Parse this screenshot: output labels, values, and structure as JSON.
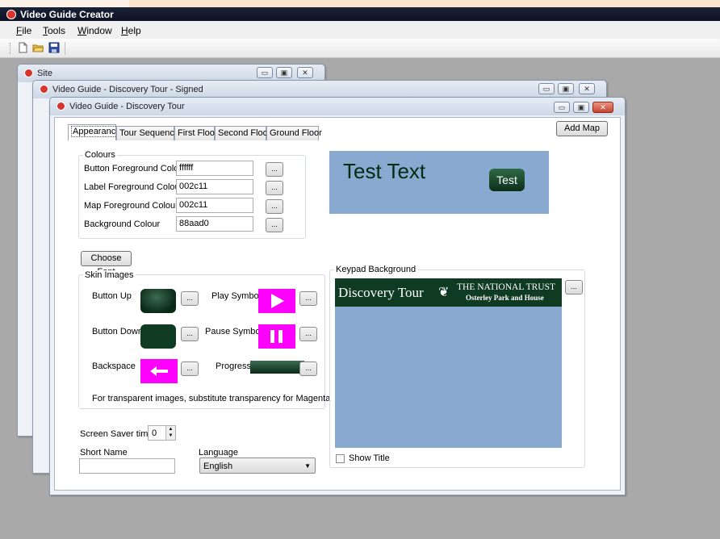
{
  "app": {
    "title": "Video Guide Creator"
  },
  "menu": {
    "file": "File",
    "tools": "Tools",
    "window": "Window",
    "help": "Help"
  },
  "toolbar": {
    "icons": [
      "new-document-icon",
      "open-folder-icon",
      "save-icon"
    ]
  },
  "windows": {
    "site": {
      "title": "Site"
    },
    "signed": {
      "title": "Video Guide - Discovery Tour - Signed"
    },
    "main": {
      "title": "Video Guide - Discovery Tour"
    }
  },
  "tabs": [
    {
      "label": "Appearance",
      "active": true
    },
    {
      "label": "Tour Sequence"
    },
    {
      "label": "First Floor"
    },
    {
      "label": "Second Floor"
    },
    {
      "label": "Ground Floor"
    }
  ],
  "add_map": "Add Map",
  "colours": {
    "legend": "Colours",
    "button_fg_label": "Button Foreground Colour",
    "button_fg_value": "ffffff",
    "label_fg_label": "Label Foreground Colour",
    "label_fg_value": "002c11",
    "map_fg_label": "Map Foreground Colour",
    "map_fg_value": "002c11",
    "background_label": "Background Colour",
    "background_value": "88aad0",
    "browse": "..."
  },
  "preview": {
    "test_text": "Test Text",
    "test_button": "Test",
    "bg_color": "#88aad0",
    "fg_color": "#002c11"
  },
  "choose_font": "Choose Font",
  "skin": {
    "legend": "Skin Images",
    "button_up": "Button Up",
    "button_down": "Button Down",
    "backspace": "Backspace",
    "play_symbol": "Play Symbol",
    "pause_symbol": "Pause Symbol",
    "progress": "Progress",
    "note": "For transparent images, substitute transparency for Magenta"
  },
  "keypad": {
    "legend": "Keypad Background",
    "banner_left": "Discovery Tour",
    "banner_right1": "THE NATIONAL TRUST",
    "banner_right2": "Osterley Park and House",
    "show_title": "Show Title"
  },
  "screen_saver": {
    "label": "Screen Saver time",
    "value": "0"
  },
  "short_name": {
    "label": "Short Name",
    "value": ""
  },
  "language": {
    "label": "Language",
    "value": "English"
  }
}
